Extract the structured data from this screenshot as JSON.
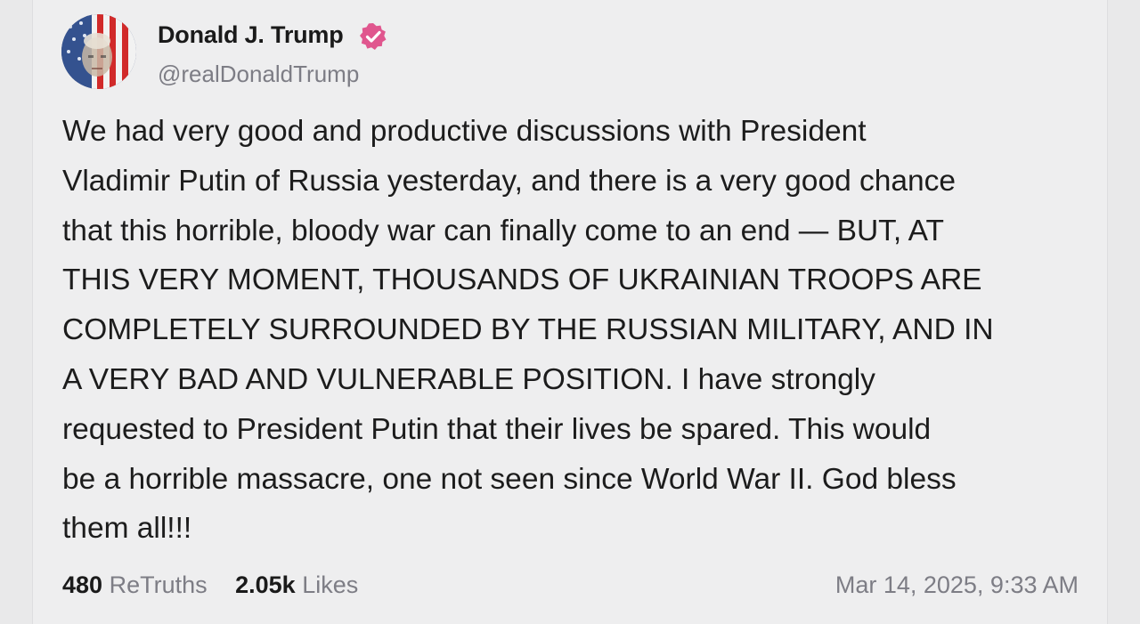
{
  "post": {
    "author": {
      "display_name": "Donald J. Trump",
      "handle": "@realDonaldTrump",
      "verified": true,
      "verified_color": "#e0568e",
      "avatar_icon": "profile-photo-flag-portrait"
    },
    "body": "We had very good and productive discussions with President\nVladimir Putin of Russia yesterday, and there is a very good chance\nthat this horrible, bloody war can finally come to an end — BUT, AT\nTHIS VERY MOMENT, THOUSANDS OF UKRAINIAN TROOPS ARE\nCOMPLETELY SURROUNDED BY THE RUSSIAN MILITARY, AND IN\nA VERY BAD AND VULNERABLE POSITION. I have strongly\nrequested to President Putin that their lives be spared. This would\nbe a horrible massacre, one not seen since World War II. God bless\nthem all!!!",
    "stats": {
      "retruths_count": "480",
      "retruths_label": "ReTruths",
      "likes_count": "2.05k",
      "likes_label": "Likes"
    },
    "timestamp": "Mar 14, 2025, 9:33 AM"
  },
  "colors": {
    "background": "#e9e9ea",
    "card": "#eeeeef",
    "text_primary": "#1c1c1c",
    "text_secondary": "#7d7d85"
  }
}
